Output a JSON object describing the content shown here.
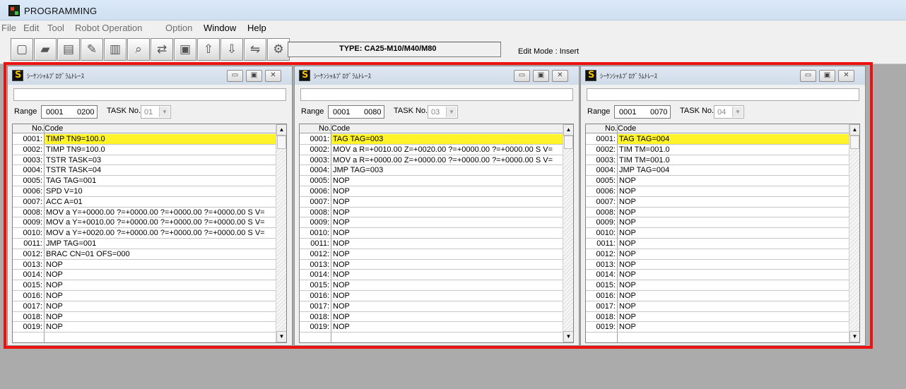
{
  "app": {
    "title": "PROGRAMMING",
    "icon": "app-logo-icon"
  },
  "menu": [
    {
      "label": "File",
      "enabled": false
    },
    {
      "label": "Edit",
      "enabled": false
    },
    {
      "label": "Tool",
      "enabled": false
    },
    {
      "label": "Robot Operation",
      "enabled": false
    },
    {
      "label": "Option",
      "enabled": false
    },
    {
      "label": "Window",
      "enabled": true
    },
    {
      "label": "Help",
      "enabled": true
    }
  ],
  "toolbar": {
    "buttons": [
      {
        "icon": "new-file-icon",
        "glyph": "▢"
      },
      {
        "icon": "open-folder-icon",
        "glyph": "▰"
      },
      {
        "icon": "save-icon",
        "glyph": "▤"
      },
      {
        "icon": "edit-tool-icon",
        "glyph": "✎"
      },
      {
        "icon": "document-icon",
        "glyph": "▥"
      },
      {
        "icon": "search-icon",
        "glyph": "⌕"
      },
      {
        "icon": "transfer-icon",
        "glyph": "⇄"
      },
      {
        "icon": "monitor-icon",
        "glyph": "▣"
      },
      {
        "icon": "upload-icon",
        "glyph": "⇧"
      },
      {
        "icon": "download-icon",
        "glyph": "⇩"
      },
      {
        "icon": "compare-icon",
        "glyph": "⇋"
      },
      {
        "icon": "settings-icon",
        "glyph": "⚙"
      }
    ],
    "type_text": "TYPE: CA25-M10/M40/M80",
    "edit_mode": "Edit Mode : Insert"
  },
  "colors": {
    "selected_row": "#fff32a",
    "highlight_frame": "#ee1111"
  },
  "panels": [
    {
      "title": "ｼｰｹﾝｼｬﾙﾌﾟﾛｸﾞﾗﾑﾄﾚｰｽ",
      "range_label": "Range",
      "range_start": "0001",
      "range_end": "0200",
      "task_label": "TASK No.",
      "task_value": "01",
      "col_no": "No.",
      "col_code": "Code",
      "rows": [
        {
          "no": "0001:",
          "code": "TIMP TN9=100.0"
        },
        {
          "no": "0002:",
          "code": "TIMP TN9=100.0"
        },
        {
          "no": "0003:",
          "code": "TSTR TASK=03"
        },
        {
          "no": "0004:",
          "code": "TSTR TASK=04"
        },
        {
          "no": "0005:",
          "code": "TAG TAG=001"
        },
        {
          "no": "0006:",
          "code": "SPD V=10"
        },
        {
          "no": "0007:",
          "code": "ACC A=01"
        },
        {
          "no": "0008:",
          "code": "MOV a Y=+0000.00 ?=+0000.00 ?=+0000.00 ?=+0000.00 S V="
        },
        {
          "no": "0009:",
          "code": "MOV a Y=+0010.00 ?=+0000.00 ?=+0000.00 ?=+0000.00 S V="
        },
        {
          "no": "0010:",
          "code": "MOV a Y=+0020.00 ?=+0000.00 ?=+0000.00 ?=+0000.00 S V="
        },
        {
          "no": "0011:",
          "code": "JMP TAG=001"
        },
        {
          "no": "0012:",
          "code": "BRAC CN=01 OFS=000"
        },
        {
          "no": "0013:",
          "code": "NOP"
        },
        {
          "no": "0014:",
          "code": "NOP"
        },
        {
          "no": "0015:",
          "code": "NOP"
        },
        {
          "no": "0016:",
          "code": "NOP"
        },
        {
          "no": "0017:",
          "code": "NOP"
        },
        {
          "no": "0018:",
          "code": "NOP"
        },
        {
          "no": "0019:",
          "code": "NOP"
        }
      ]
    },
    {
      "title": "ｼｰｹﾝｼｬﾙﾌﾟﾛｸﾞﾗﾑﾄﾚｰｽ",
      "range_label": "Range",
      "range_start": "0001",
      "range_end": "0080",
      "task_label": "TASK No.",
      "task_value": "03",
      "col_no": "No.",
      "col_code": "Code",
      "rows": [
        {
          "no": "0001:",
          "code": "TAG TAG=003"
        },
        {
          "no": "0002:",
          "code": "MOV a R=+0010.00 Z=+0020.00 ?=+0000.00 ?=+0000.00 S V="
        },
        {
          "no": "0003:",
          "code": "MOV a R=+0000.00 Z=+0000.00 ?=+0000.00 ?=+0000.00 S V="
        },
        {
          "no": "0004:",
          "code": "JMP TAG=003"
        },
        {
          "no": "0005:",
          "code": "NOP"
        },
        {
          "no": "0006:",
          "code": "NOP"
        },
        {
          "no": "0007:",
          "code": "NOP"
        },
        {
          "no": "0008:",
          "code": "NOP"
        },
        {
          "no": "0009:",
          "code": "NOP"
        },
        {
          "no": "0010:",
          "code": "NOP"
        },
        {
          "no": "0011:",
          "code": "NOP"
        },
        {
          "no": "0012:",
          "code": "NOP"
        },
        {
          "no": "0013:",
          "code": "NOP"
        },
        {
          "no": "0014:",
          "code": "NOP"
        },
        {
          "no": "0015:",
          "code": "NOP"
        },
        {
          "no": "0016:",
          "code": "NOP"
        },
        {
          "no": "0017:",
          "code": "NOP"
        },
        {
          "no": "0018:",
          "code": "NOP"
        },
        {
          "no": "0019:",
          "code": "NOP"
        }
      ]
    },
    {
      "title": "ｼｰｹﾝｼｬﾙﾌﾟﾛｸﾞﾗﾑﾄﾚｰｽ",
      "range_label": "Range",
      "range_start": "0001",
      "range_end": "0070",
      "task_label": "TASK No.",
      "task_value": "04",
      "col_no": "No.",
      "col_code": "Code",
      "rows": [
        {
          "no": "0001:",
          "code": "TAG TAG=004"
        },
        {
          "no": "0002:",
          "code": "TIM TM=001.0"
        },
        {
          "no": "0003:",
          "code": "TIM TM=001.0"
        },
        {
          "no": "0004:",
          "code": "JMP TAG=004"
        },
        {
          "no": "0005:",
          "code": "NOP"
        },
        {
          "no": "0006:",
          "code": "NOP"
        },
        {
          "no": "0007:",
          "code": "NOP"
        },
        {
          "no": "0008:",
          "code": "NOP"
        },
        {
          "no": "0009:",
          "code": "NOP"
        },
        {
          "no": "0010:",
          "code": "NOP"
        },
        {
          "no": "0011:",
          "code": "NOP"
        },
        {
          "no": "0012:",
          "code": "NOP"
        },
        {
          "no": "0013:",
          "code": "NOP"
        },
        {
          "no": "0014:",
          "code": "NOP"
        },
        {
          "no": "0015:",
          "code": "NOP"
        },
        {
          "no": "0016:",
          "code": "NOP"
        },
        {
          "no": "0017:",
          "code": "NOP"
        },
        {
          "no": "0018:",
          "code": "NOP"
        },
        {
          "no": "0019:",
          "code": "NOP"
        }
      ]
    }
  ]
}
